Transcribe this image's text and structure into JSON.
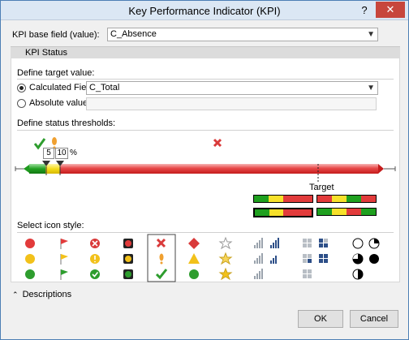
{
  "window": {
    "title": "Key Performance Indicator (KPI)",
    "help_glyph": "?",
    "close_glyph": "✕"
  },
  "base_field": {
    "label": "KPI base field (value):",
    "value": "C_Absence"
  },
  "kpi_status": {
    "tab_label": "KPI Status",
    "define_target_label": "Define target value:",
    "calculated_field_label": "Calculated Field:",
    "calculated_field_value": "C_Total",
    "calculated_selected": true,
    "absolute_value_label": "Absolute value:",
    "absolute_value_value": "",
    "thresholds_label": "Define status thresholds:",
    "threshold_low": "5",
    "threshold_high": "10",
    "threshold_unit": "%",
    "target_label": "Target",
    "icon_style_label": "Select icon style:",
    "selected_icon_set_index": 4
  },
  "colors": {
    "green": "#1fa01f",
    "yellow": "#f7e12a",
    "red": "#e23b3b",
    "border_accent": "#4d7fb5"
  },
  "icon_sets": [
    {
      "name": "circles",
      "icons": [
        "red-circle-icon",
        "yellow-circle-icon",
        "green-circle-icon"
      ]
    },
    {
      "name": "flags",
      "icons": [
        "red-flag-icon",
        "yellow-flag-icon",
        "green-flag-icon"
      ]
    },
    {
      "name": "symbols-circled",
      "icons": [
        "red-x-circle-icon",
        "yellow-exclamation-circle-icon",
        "green-check-circle-icon"
      ]
    },
    {
      "name": "traffic-lights",
      "icons": [
        "red-light-icon",
        "yellow-light-icon",
        "green-light-icon"
      ]
    },
    {
      "name": "symbols",
      "icons": [
        "red-x-icon",
        "yellow-exclamation-icon",
        "green-check-icon"
      ]
    },
    {
      "name": "shapes",
      "icons": [
        "red-diamond-icon",
        "yellow-triangle-icon",
        "green-circle-icon"
      ]
    },
    {
      "name": "stars",
      "icons": [
        "empty-star-icon",
        "half-star-icon",
        "full-star-icon"
      ]
    },
    {
      "name": "signal-bars",
      "icons": [
        "bars-4-icon",
        "bars-3-icon",
        "bars-2-icon"
      ]
    },
    {
      "name": "boxes",
      "icons": [
        "boxes-1-icon",
        "boxes-2-icon",
        "boxes-3-icon"
      ]
    },
    {
      "name": "pies",
      "icons": [
        "empty-pie-icon",
        "quarter-pie-icon",
        "half-pie-icon",
        "three-quarter-pie-icon",
        "full-pie-icon"
      ]
    }
  ],
  "footer": {
    "descriptions_label": "Descriptions",
    "ok_label": "OK",
    "cancel_label": "Cancel"
  }
}
